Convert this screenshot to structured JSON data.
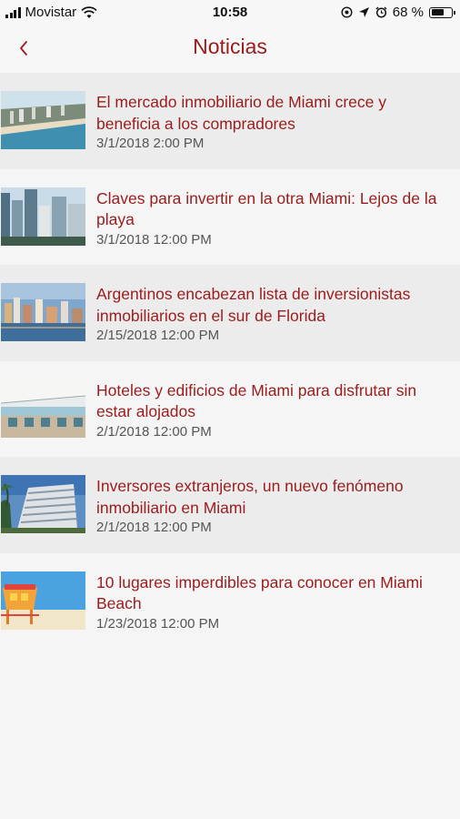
{
  "status_bar": {
    "carrier": "Movistar",
    "time": "10:58",
    "battery": "68 %",
    "battery_level": 0.68
  },
  "nav": {
    "back_icon": "chevron-left-icon",
    "title": "Noticias"
  },
  "news": [
    {
      "title": "El mercado inmobiliario de Miami crece y beneficia a los compradores",
      "date": "3/1/2018 2:00 PM",
      "thumb": "aerial-beach-coast"
    },
    {
      "title": "Claves para invertir en la otra Miami: Lejos de la playa",
      "date": "3/1/2018 12:00 PM",
      "thumb": "city-skyline-towers"
    },
    {
      "title": "Argentinos encabezan lista de inversionistas inmobiliarios en el sur de Florida",
      "date": "2/15/2018 12:00 PM",
      "thumb": "skyline-dusk-water"
    },
    {
      "title": "Hoteles y edificios de Miami para disfrutar sin estar alojados",
      "date": "2/1/2018 12:00 PM",
      "thumb": "hotel-terrace-dining"
    },
    {
      "title": "Inversores extranjeros, un nuevo fenómeno inmobiliario en Miami",
      "date": "2/1/2018 12:00 PM",
      "thumb": "modern-building-palms"
    },
    {
      "title": "10 lugares imperdibles para conocer en Miami Beach",
      "date": "1/23/2018 12:00 PM",
      "thumb": "lifeguard-tower-beach"
    }
  ],
  "colors": {
    "accent": "#9b1c1c",
    "background": "#f5f5f5",
    "row_alt": "#ececec",
    "date_text": "#555555"
  }
}
